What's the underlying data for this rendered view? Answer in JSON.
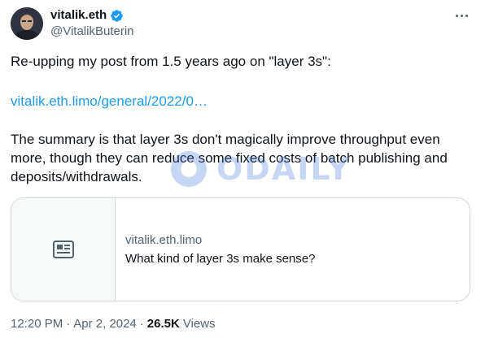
{
  "author": {
    "name": "vitalik.eth",
    "handle": "@VitalikButerin",
    "verified": true,
    "verified_color": "#1d9bf0"
  },
  "tweet": {
    "text_line1": "Re-upping my post from 1.5 years ago on \"layer 3s\":",
    "link_text": "vitalik.eth.limo/general/2022/0…",
    "text_paragraph2": "The summary is that layer 3s don't magically improve throughput even more, though they can reduce some fixed costs of batch publishing and deposits/withdrawals."
  },
  "card": {
    "domain": "vitalik.eth.limo",
    "title": "What kind of layer 3s make sense?",
    "thumb_icon": "article-icon"
  },
  "meta": {
    "time": "12:20 PM",
    "sep1": "·",
    "date": "Apr 2, 2024",
    "sep2": "·",
    "views_count": "26.5K",
    "views_label": "Views"
  },
  "watermark": {
    "text": "ODAILY"
  },
  "colors": {
    "link": "#1d9bf0",
    "secondary_text": "#536471",
    "primary_text": "#0f1419",
    "border": "#cfd9de"
  }
}
